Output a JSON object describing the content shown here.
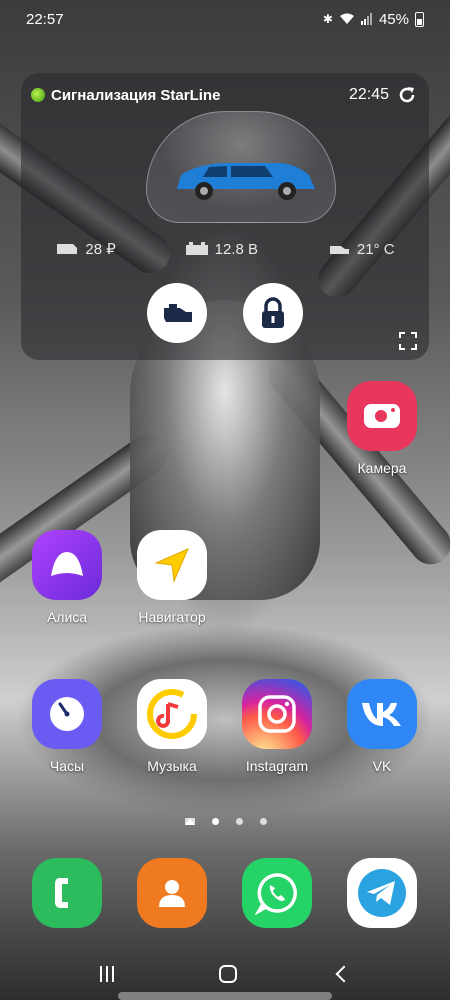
{
  "status_bar": {
    "time": "22:57",
    "battery": "45%"
  },
  "widget": {
    "title": "Сигнализация StarLine",
    "time": "22:45",
    "balance": "28 ₽",
    "voltage": "12.8 В",
    "temperature": "21° C",
    "car_color": "#1f7fd6"
  },
  "apps": [
    {
      "label": "Камера",
      "icon": "camera-icon",
      "color": "#e8365d"
    },
    {
      "label": "Алиса",
      "icon": "alice-icon",
      "color": "#8a3bf3"
    },
    {
      "label": "Навигатор",
      "icon": "navigator-icon",
      "color": "#ffffff"
    },
    {
      "label": "Часы",
      "icon": "clock-icon",
      "color": "#6a5cf2"
    },
    {
      "label": "Музыка",
      "icon": "music-icon",
      "color": "#ffffff"
    },
    {
      "label": "Instagram",
      "icon": "instagram-icon",
      "color": "#d6249f"
    },
    {
      "label": "VK",
      "icon": "vk-icon",
      "color": "#2f87f5"
    }
  ],
  "dock": [
    {
      "icon": "phone-icon",
      "color": "#2cbc5d"
    },
    {
      "icon": "contacts-icon",
      "color": "#f07a1f"
    },
    {
      "icon": "whatsapp-icon",
      "color": "#25d366"
    },
    {
      "icon": "telegram-icon",
      "color": "#ffffff"
    }
  ]
}
